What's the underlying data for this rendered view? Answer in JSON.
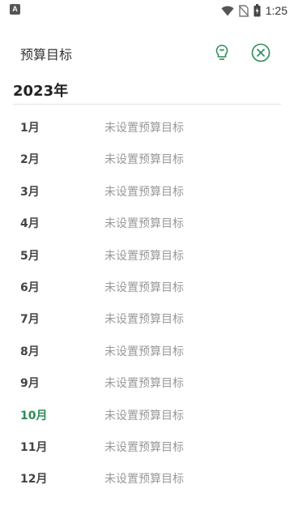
{
  "status_bar": {
    "left_icon": "A",
    "time": "1:25",
    "icons": [
      "wifi-icon",
      "no-sim-icon",
      "battery-icon"
    ]
  },
  "header": {
    "title": "预算目标",
    "bulb_icon": "lightbulb-icon",
    "close_icon": "close-circle-icon"
  },
  "year": "2023年",
  "accent_color": "#2e8b57",
  "months": [
    {
      "label": "1月",
      "status": "未设置预算目标"
    },
    {
      "label": "2月",
      "status": "未设置预算目标"
    },
    {
      "label": "3月",
      "status": "未设置预算目标"
    },
    {
      "label": "4月",
      "status": "未设置预算目标"
    },
    {
      "label": "5月",
      "status": "未设置预算目标"
    },
    {
      "label": "6月",
      "status": "未设置预算目标"
    },
    {
      "label": "7月",
      "status": "未设置预算目标"
    },
    {
      "label": "8月",
      "status": "未设置预算目标"
    },
    {
      "label": "9月",
      "status": "未设置预算目标"
    },
    {
      "label": "10月",
      "status": "未设置预算目标"
    },
    {
      "label": "11月",
      "status": "未设置预算目标"
    },
    {
      "label": "12月",
      "status": "未设置预算目标"
    }
  ]
}
